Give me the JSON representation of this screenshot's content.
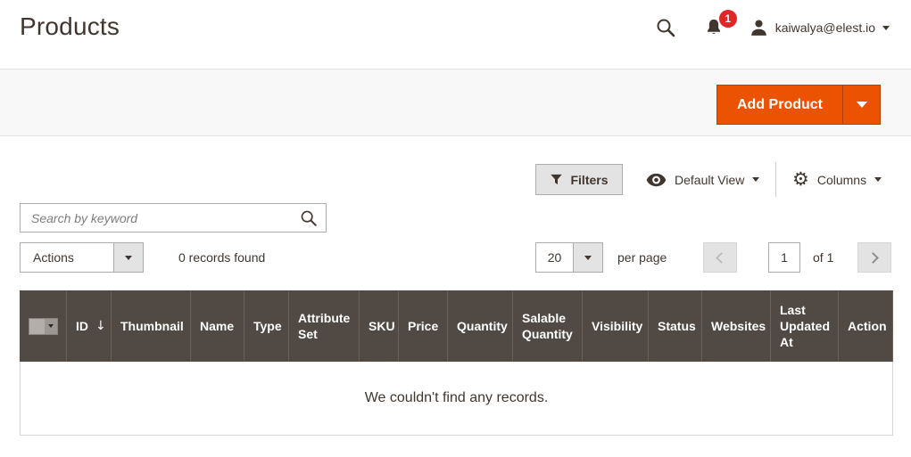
{
  "page_title": "Products",
  "header": {
    "notifications": {
      "count": "1"
    },
    "user": {
      "email": "kaiwalya@elest.io"
    }
  },
  "toolbar": {
    "add_product": "Add Product"
  },
  "grid_controls": {
    "filters": "Filters",
    "default_view": "Default View",
    "columns": "Columns"
  },
  "keyword_search": {
    "placeholder": "Search by keyword"
  },
  "actions_bar": {
    "actions": "Actions",
    "records_found": "0 records found"
  },
  "pagination": {
    "page_size": "20",
    "per_page": "per page",
    "current_page": "1",
    "of_total": "of 1"
  },
  "table": {
    "columns": [
      "ID",
      "Thumbnail",
      "Name",
      "Type",
      "Attribute Set",
      "SKU",
      "Price",
      "Quantity",
      "Salable Quantity",
      "Visibility",
      "Status",
      "Websites",
      "Last Updated At",
      "Action"
    ],
    "sort": {
      "column": "ID",
      "direction": "descending",
      "glyph": "↓"
    },
    "empty_message": "We couldn't find any records."
  },
  "colors": {
    "accent_orange": "#eb5202",
    "grid_header_bg": "#514943",
    "notification_badge": "#e22626",
    "text_dark": "#41362f",
    "control_border": "#adadad",
    "control_gray": "#e3e3e3",
    "bar_gray": "#f8f8f8"
  }
}
